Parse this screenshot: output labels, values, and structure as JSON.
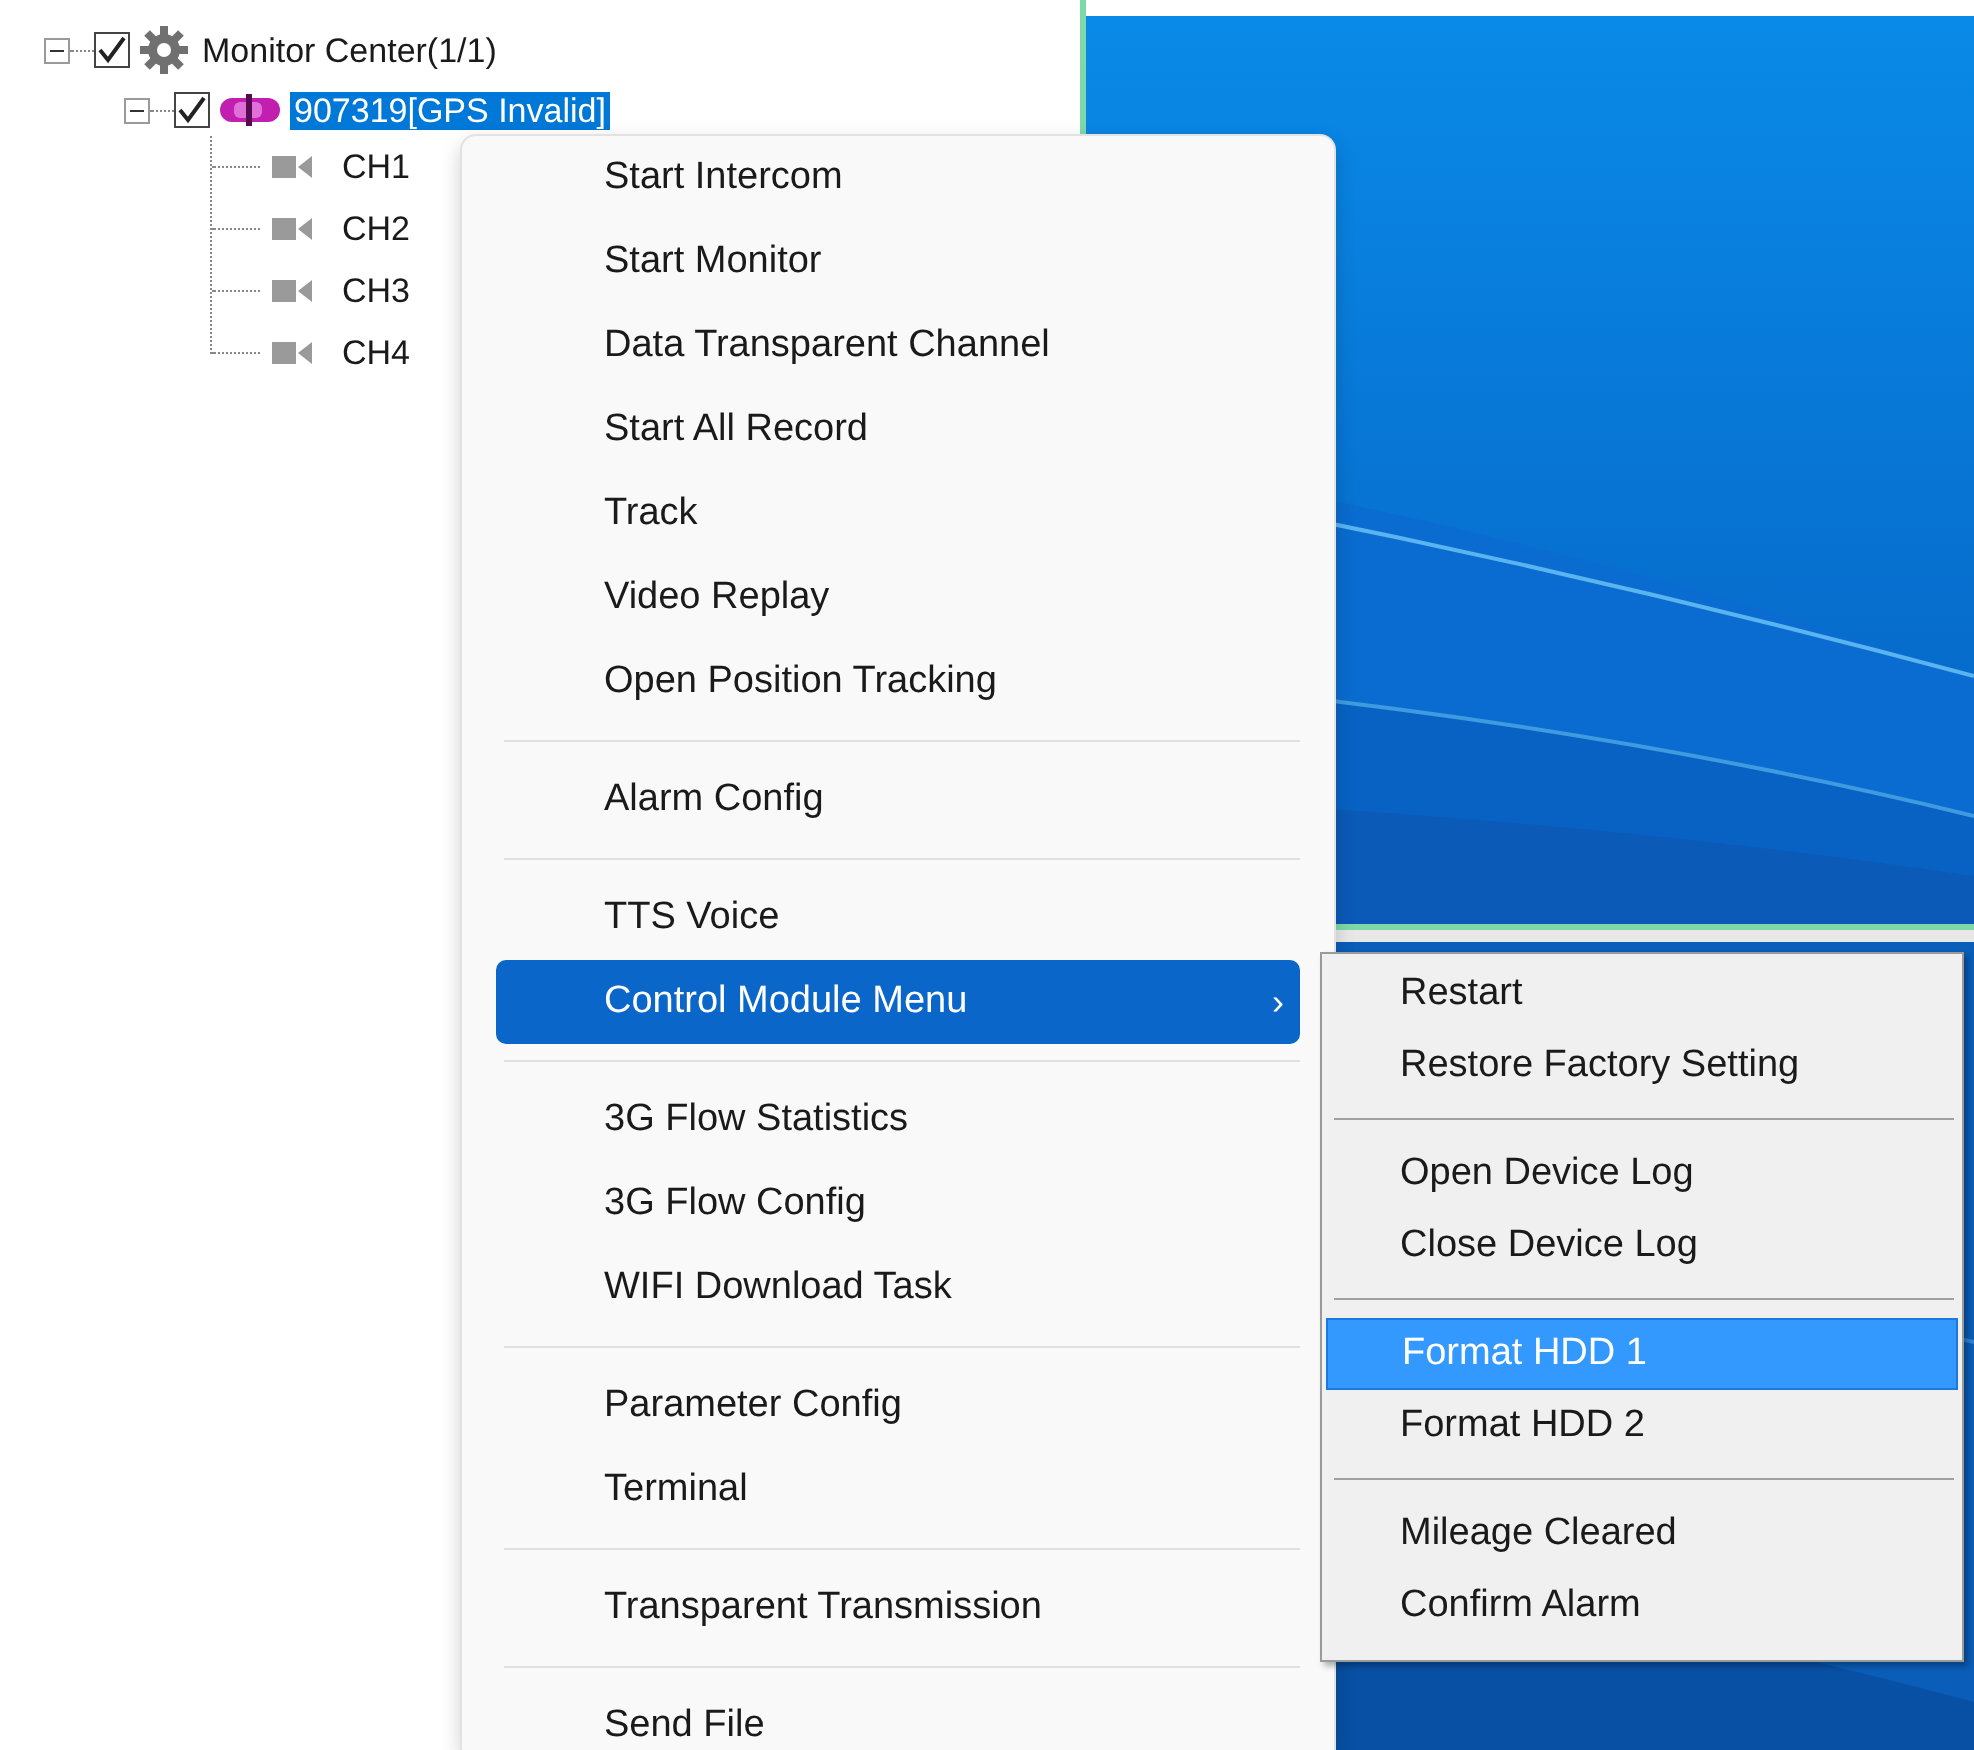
{
  "tree": [
    {
      "label": "Monitor Center(1/1)",
      "kind": "gear",
      "checked": true,
      "expanded": true,
      "selected": false,
      "children": [
        {
          "label": "907319[GPS Invalid]",
          "kind": "car",
          "checked": true,
          "expanded": true,
          "selected": true,
          "children": [
            {
              "label": "CH1",
              "kind": "camera",
              "selected": false
            },
            {
              "label": "CH2",
              "kind": "camera",
              "selected": false
            },
            {
              "label": "CH3",
              "kind": "camera",
              "selected": false
            },
            {
              "label": "CH4",
              "kind": "camera",
              "selected": false
            }
          ]
        }
      ]
    }
  ],
  "context_menu": {
    "items": [
      {
        "kind": "item",
        "label": "Start Intercom",
        "selected": false
      },
      {
        "kind": "item",
        "label": "Start Monitor",
        "selected": false
      },
      {
        "kind": "item",
        "label": "Data Transparent Channel",
        "selected": false
      },
      {
        "kind": "item",
        "label": "Start All Record",
        "selected": false
      },
      {
        "kind": "item",
        "label": "Track",
        "selected": false
      },
      {
        "kind": "item",
        "label": "Video Replay",
        "selected": false
      },
      {
        "kind": "item",
        "label": "Open Position Tracking",
        "selected": false
      },
      {
        "kind": "separator"
      },
      {
        "kind": "item",
        "label": "Alarm Config",
        "selected": false
      },
      {
        "kind": "separator"
      },
      {
        "kind": "item",
        "label": "TTS Voice",
        "selected": false
      },
      {
        "kind": "item",
        "label": "Control Module Menu",
        "selected": true,
        "arrow": "›"
      },
      {
        "kind": "separator"
      },
      {
        "kind": "item",
        "label": "3G Flow Statistics",
        "selected": false
      },
      {
        "kind": "item",
        "label": "3G Flow Config",
        "selected": false
      },
      {
        "kind": "item",
        "label": "WIFI Download Task",
        "selected": false
      },
      {
        "kind": "separator"
      },
      {
        "kind": "item",
        "label": "Parameter Config",
        "selected": false
      },
      {
        "kind": "item",
        "label": "Terminal",
        "selected": false
      },
      {
        "kind": "separator"
      },
      {
        "kind": "item",
        "label": "Transparent Transmission",
        "selected": false
      },
      {
        "kind": "separator"
      },
      {
        "kind": "item",
        "label": "Send File",
        "selected": false
      }
    ]
  },
  "submenu": {
    "items": [
      {
        "kind": "item",
        "label": "Restart",
        "selected": false
      },
      {
        "kind": "item",
        "label": "Restore Factory Setting",
        "selected": false
      },
      {
        "kind": "separator"
      },
      {
        "kind": "item",
        "label": "Open Device Log",
        "selected": false
      },
      {
        "kind": "item",
        "label": "Close Device Log",
        "selected": false
      },
      {
        "kind": "separator"
      },
      {
        "kind": "item",
        "label": "Format HDD 1",
        "selected": true
      },
      {
        "kind": "item",
        "label": "Format HDD 2",
        "selected": false
      },
      {
        "kind": "separator"
      },
      {
        "kind": "item",
        "label": "Mileage Cleared",
        "selected": false
      },
      {
        "kind": "item",
        "label": "Confirm Alarm",
        "selected": false
      }
    ]
  }
}
